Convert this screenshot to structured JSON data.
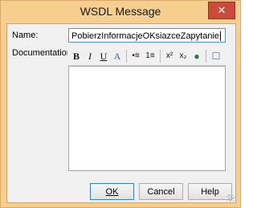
{
  "window": {
    "title": "WSDL Message",
    "close_glyph": "✕"
  },
  "form": {
    "name_label": "Name:",
    "name_value": "PobierzInformacjeOKsiazceZapytanie",
    "doc_label": "Documentation:",
    "doc_value": ""
  },
  "toolbar": [
    {
      "icon": "bold-icon",
      "glyph": "B"
    },
    {
      "icon": "italic-icon",
      "glyph": "I"
    },
    {
      "icon": "underline-icon",
      "glyph": "U"
    },
    {
      "icon": "font-color-icon",
      "glyph": "A"
    },
    {
      "icon": "bulleted-list-icon",
      "glyph": "•≡"
    },
    {
      "icon": "numbered-list-icon",
      "glyph": "1≡"
    },
    {
      "icon": "superscript-icon",
      "glyph": "x²"
    },
    {
      "icon": "subscript-icon",
      "glyph": "x₂"
    },
    {
      "icon": "hyperlink-icon",
      "glyph": "●"
    },
    {
      "icon": "page-icon",
      "glyph": "☐"
    }
  ],
  "buttons": {
    "ok": "OK",
    "cancel": "Cancel",
    "help": "Help"
  },
  "colors": {
    "frame": "#f6ce8f",
    "close": "#c94c3b",
    "focus": "#5b94c8"
  }
}
